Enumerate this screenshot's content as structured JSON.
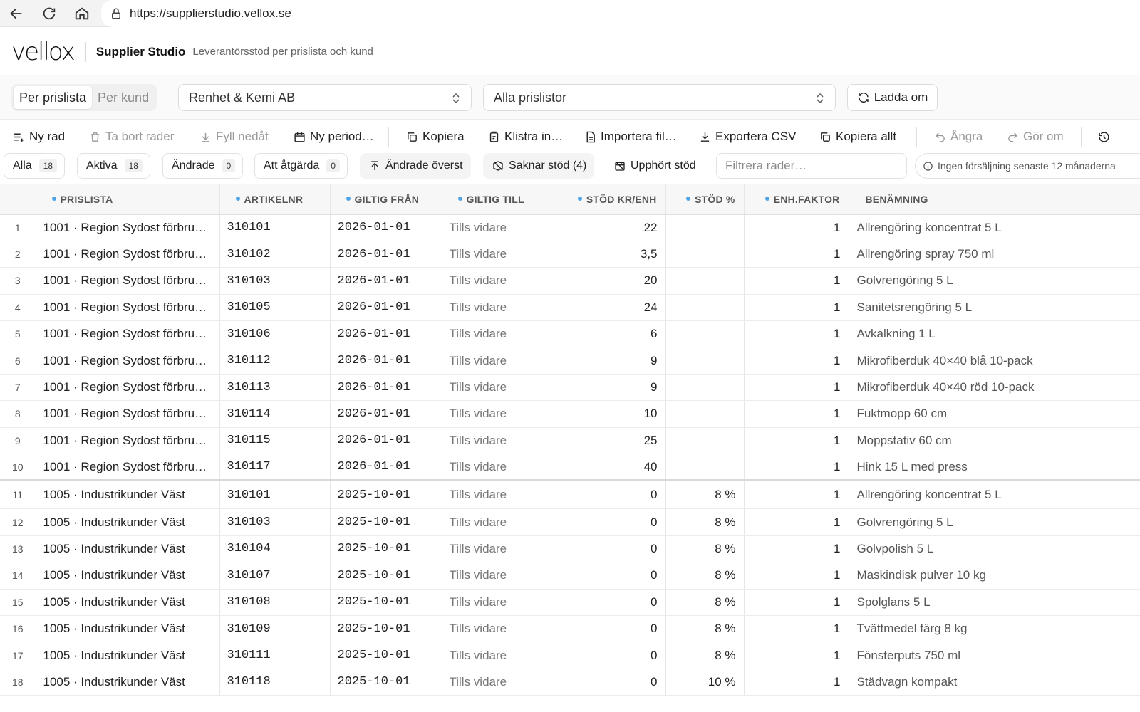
{
  "browser": {
    "url": "https://supplierstudio.vellox.se"
  },
  "header": {
    "logo": "vellox",
    "title": "Supplier Studio",
    "subtitle": "Leverantörsstöd per prislista och kund"
  },
  "selectors": {
    "mode_tabs": [
      "Per prislista",
      "Per kund"
    ],
    "active_mode": "Per prislista",
    "supplier": "Renhet & Kemi AB",
    "pricelist": "Alla prislistor",
    "reload_label": "Ladda om"
  },
  "toolbar": {
    "new_row": "Ny rad",
    "delete_rows": "Ta bort rader",
    "fill_down": "Fyll nedåt",
    "new_period": "Ny period…",
    "copy": "Kopiera",
    "paste": "Klistra in…",
    "import_file": "Importera fil…",
    "export_csv": "Exportera CSV",
    "copy_all": "Kopiera allt",
    "undo": "Ångra",
    "redo": "Gör om"
  },
  "filters": {
    "all": {
      "label": "Alla",
      "count": "18"
    },
    "active": {
      "label": "Aktiva",
      "count": "18"
    },
    "changed": {
      "label": "Ändrade",
      "count": "0"
    },
    "todo": {
      "label": "Att åtgärda",
      "count": "0"
    },
    "changed_top": "Ändrade överst",
    "missing_support": "Saknar stöd (4)",
    "ended_support": "Upphört stöd",
    "search_placeholder": "Filtrera rader…",
    "info": "Ingen försäljning senaste 12 månaderna"
  },
  "table": {
    "columns": [
      "PRISLISTA",
      "ARTIKELNR",
      "GILTIG FRÅN",
      "GILTIG TILL",
      "STÖD KR/ENH",
      "STÖD %",
      "ENH.FAKTOR",
      "BENÄMNING"
    ],
    "rows": [
      {
        "n": "1",
        "pricelist": "1001 · Region Sydost förbruk…",
        "article": "310101",
        "from": "2026-01-01",
        "to": "Tills vidare",
        "kr": "22",
        "pct": "",
        "factor": "1",
        "desc": "Allrengöring koncentrat 5 L"
      },
      {
        "n": "2",
        "pricelist": "1001 · Region Sydost förbruk…",
        "article": "310102",
        "from": "2026-01-01",
        "to": "Tills vidare",
        "kr": "3,5",
        "pct": "",
        "factor": "1",
        "desc": "Allrengöring spray 750 ml"
      },
      {
        "n": "3",
        "pricelist": "1001 · Region Sydost förbruk…",
        "article": "310103",
        "from": "2026-01-01",
        "to": "Tills vidare",
        "kr": "20",
        "pct": "",
        "factor": "1",
        "desc": "Golvrengöring 5 L"
      },
      {
        "n": "4",
        "pricelist": "1001 · Region Sydost förbruk…",
        "article": "310105",
        "from": "2026-01-01",
        "to": "Tills vidare",
        "kr": "24",
        "pct": "",
        "factor": "1",
        "desc": "Sanitetsrengöring 5 L"
      },
      {
        "n": "5",
        "pricelist": "1001 · Region Sydost förbruk…",
        "article": "310106",
        "from": "2026-01-01",
        "to": "Tills vidare",
        "kr": "6",
        "pct": "",
        "factor": "1",
        "desc": "Avkalkning 1 L"
      },
      {
        "n": "6",
        "pricelist": "1001 · Region Sydost förbruk…",
        "article": "310112",
        "from": "2026-01-01",
        "to": "Tills vidare",
        "kr": "9",
        "pct": "",
        "factor": "1",
        "desc": "Mikrofiberduk 40×40 blå 10-pack"
      },
      {
        "n": "7",
        "pricelist": "1001 · Region Sydost förbruk…",
        "article": "310113",
        "from": "2026-01-01",
        "to": "Tills vidare",
        "kr": "9",
        "pct": "",
        "factor": "1",
        "desc": "Mikrofiberduk 40×40 röd 10-pack"
      },
      {
        "n": "8",
        "pricelist": "1001 · Region Sydost förbruk…",
        "article": "310114",
        "from": "2026-01-01",
        "to": "Tills vidare",
        "kr": "10",
        "pct": "",
        "factor": "1",
        "desc": "Fuktmopp 60 cm"
      },
      {
        "n": "9",
        "pricelist": "1001 · Region Sydost förbruk…",
        "article": "310115",
        "from": "2026-01-01",
        "to": "Tills vidare",
        "kr": "25",
        "pct": "",
        "factor": "1",
        "desc": "Moppstativ 60 cm"
      },
      {
        "n": "10",
        "pricelist": "1001 · Region Sydost förbruk…",
        "article": "310117",
        "from": "2026-01-01",
        "to": "Tills vidare",
        "kr": "40",
        "pct": "",
        "factor": "1",
        "desc": "Hink 15 L med press"
      },
      {
        "n": "11",
        "pricelist": "1005 · Industrikunder Väst",
        "article": "310101",
        "from": "2025-10-01",
        "to": "Tills vidare",
        "kr": "0",
        "pct": "8 %",
        "factor": "1",
        "desc": "Allrengöring koncentrat 5 L"
      },
      {
        "n": "12",
        "pricelist": "1005 · Industrikunder Väst",
        "article": "310103",
        "from": "2025-10-01",
        "to": "Tills vidare",
        "kr": "0",
        "pct": "8 %",
        "factor": "1",
        "desc": "Golvrengöring 5 L"
      },
      {
        "n": "13",
        "pricelist": "1005 · Industrikunder Väst",
        "article": "310104",
        "from": "2025-10-01",
        "to": "Tills vidare",
        "kr": "0",
        "pct": "8 %",
        "factor": "1",
        "desc": "Golvpolish 5 L"
      },
      {
        "n": "14",
        "pricelist": "1005 · Industrikunder Väst",
        "article": "310107",
        "from": "2025-10-01",
        "to": "Tills vidare",
        "kr": "0",
        "pct": "8 %",
        "factor": "1",
        "desc": "Maskindisk pulver 10 kg"
      },
      {
        "n": "15",
        "pricelist": "1005 · Industrikunder Väst",
        "article": "310108",
        "from": "2025-10-01",
        "to": "Tills vidare",
        "kr": "0",
        "pct": "8 %",
        "factor": "1",
        "desc": "Spolglans 5 L"
      },
      {
        "n": "16",
        "pricelist": "1005 · Industrikunder Väst",
        "article": "310109",
        "from": "2025-10-01",
        "to": "Tills vidare",
        "kr": "0",
        "pct": "8 %",
        "factor": "1",
        "desc": "Tvättmedel färg 8 kg"
      },
      {
        "n": "17",
        "pricelist": "1005 · Industrikunder Väst",
        "article": "310111",
        "from": "2025-10-01",
        "to": "Tills vidare",
        "kr": "0",
        "pct": "8 %",
        "factor": "1",
        "desc": "Fönsterputs 750 ml"
      },
      {
        "n": "18",
        "pricelist": "1005 · Industrikunder Väst",
        "article": "310118",
        "from": "2025-10-01",
        "to": "Tills vidare",
        "kr": "0",
        "pct": "10 %",
        "factor": "1",
        "desc": "Städvagn kompakt"
      }
    ]
  },
  "colors": {
    "column_dot": "#4da3e8",
    "header_bg": "#f7f7f7",
    "muted_text": "#777777"
  }
}
